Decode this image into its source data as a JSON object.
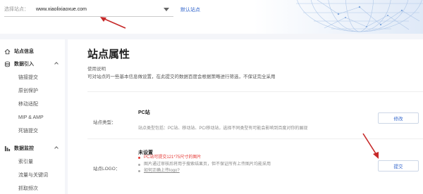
{
  "header": {
    "site_picker_label": "选择站点：",
    "site_picker_value": "www.xiaolixiaoxue.com",
    "default_site": "默认站点"
  },
  "sidebar": {
    "items": [
      {
        "label": "站点信息",
        "type": "section",
        "icon": "home-icon"
      },
      {
        "label": "数据引入",
        "type": "section",
        "icon": "database-icon",
        "expanded": true
      },
      {
        "label": "链接提交",
        "type": "sub"
      },
      {
        "label": "原创保护",
        "type": "sub"
      },
      {
        "label": "移动适配",
        "type": "sub"
      },
      {
        "label": "MIP & AMP",
        "type": "sub"
      },
      {
        "label": "死链提交",
        "type": "sub"
      },
      {
        "label": "数据监控",
        "type": "section",
        "icon": "monitor-icon",
        "expanded": true
      },
      {
        "label": "索引量",
        "type": "sub"
      },
      {
        "label": "流量与关键词",
        "type": "sub"
      },
      {
        "label": "抓取频次",
        "type": "sub"
      }
    ]
  },
  "main": {
    "title": "站点属性",
    "usage_title": "使用说明",
    "usage_text": "可对站点的一些基本信息做设置，在此提交的数据百度会根据策略进行筛选，不保证完全采用",
    "site_type": {
      "label": "站点类型：",
      "value": "PC站",
      "desc": "站点类型包括：PC站、移动站、PC/移动站，选择不同类型有可能会影响到百度对你的展现",
      "button": "修改"
    },
    "site_logo": {
      "label": "站点LOGO：",
      "value": "未设置",
      "bullets": [
        {
          "text": "PC站可提交121*75尺寸的图片",
          "color": "#e53935"
        },
        {
          "text": "图片通过审核后将用于搜索结果页，但不保证所有上传图片均能采用",
          "color": "#888888"
        },
        {
          "text": "如何正确上传logo?",
          "color": "#888888"
        }
      ],
      "button": "提交"
    }
  },
  "colors": {
    "accent": "#3366cc",
    "arrow": "#c62828",
    "warning": "#e53935"
  }
}
